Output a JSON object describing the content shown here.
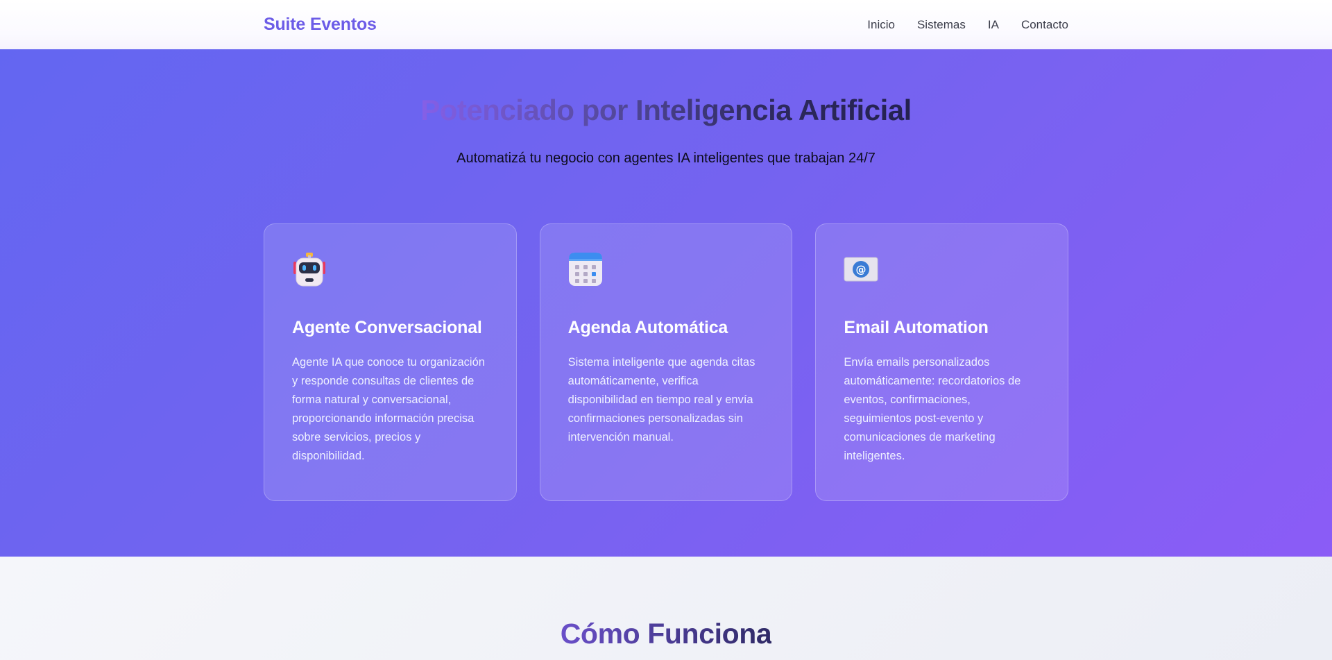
{
  "header": {
    "brand": "Suite Eventos",
    "nav": [
      "Inicio",
      "Sistemas",
      "IA",
      "Contacto"
    ]
  },
  "hero": {
    "title": "Potenciado por Inteligencia Artificial",
    "subtitle": "Automatizá tu negocio con agentes IA inteligentes que trabajan 24/7",
    "cards": [
      {
        "icon": "robot-icon",
        "title": "Agente Conversacional",
        "description": "Agente IA que conoce tu organización y responde consultas de clientes de forma natural y conversacional, proporcionando información precisa sobre servicios, precios y disponibilidad."
      },
      {
        "icon": "calendar-icon",
        "title": "Agenda Automática",
        "description": "Sistema inteligente que agenda citas automáticamente, verifica disponibilidad en tiempo real y envía confirmaciones personalizadas sin intervención manual."
      },
      {
        "icon": "email-icon",
        "title": "Email Automation",
        "description": "Envía emails personalizados automáticamente: recordatorios de eventos, confirmaciones, seguimientos post-evento y comunicaciones de marketing inteligentes."
      }
    ]
  },
  "how": {
    "title": "Cómo Funciona"
  },
  "colors": {
    "brand": "#6c5ce7",
    "hero_start": "#6366f1",
    "hero_end": "#8b5cf6"
  }
}
